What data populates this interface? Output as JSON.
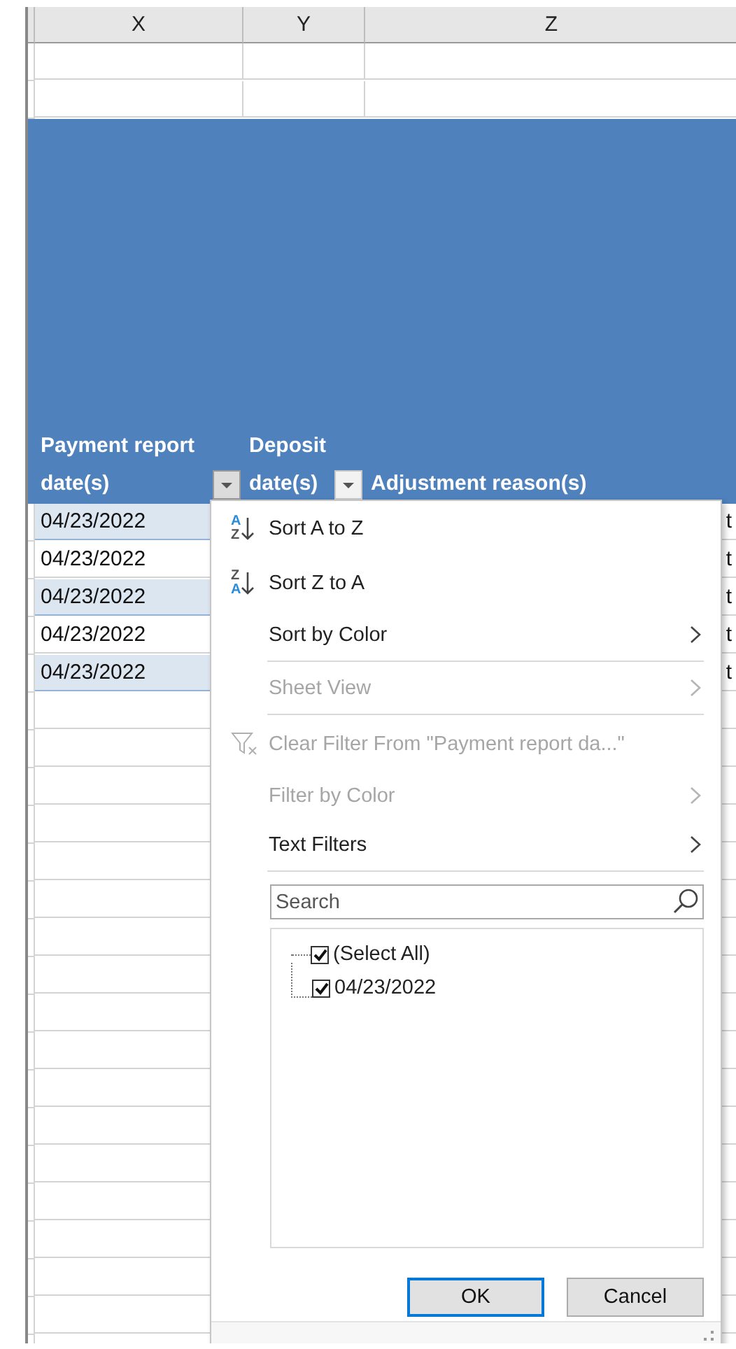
{
  "columns": [
    {
      "label": "X"
    },
    {
      "label": "Y"
    },
    {
      "label": "Z"
    }
  ],
  "header": [
    {
      "lines": [
        "Payment report",
        "date(s)"
      ],
      "filter": {
        "open": true
      }
    },
    {
      "lines": [
        "Deposit",
        "date(s)"
      ],
      "filter": {
        "open": false
      }
    },
    {
      "lines": [
        "Adjustment reason(s)"
      ]
    }
  ],
  "rows": [
    {
      "x": "04/23/2022",
      "z": "t",
      "banded": true
    },
    {
      "x": "04/23/2022",
      "z": "t",
      "banded": false
    },
    {
      "x": "04/23/2022",
      "z": "t",
      "banded": true
    },
    {
      "x": "04/23/2022",
      "z": "t",
      "banded": false
    },
    {
      "x": "04/23/2022",
      "z": "t",
      "banded": true
    }
  ],
  "filter_menu": {
    "groups": [
      [
        {
          "kind": "sort_asc",
          "label": "Sort A to Z",
          "disabled": false,
          "icon": {
            "top": "A",
            "bottom": "Z"
          }
        },
        {
          "kind": "sort_desc",
          "label": "Sort Z to A",
          "disabled": false,
          "icon": {
            "top": "Z",
            "bottom": "A"
          }
        },
        {
          "kind": "submenu",
          "label": "Sort by Color",
          "disabled": false
        }
      ],
      [
        {
          "kind": "submenu",
          "label": "Sheet View",
          "disabled": true
        }
      ],
      [
        {
          "kind": "clear_filter",
          "label": "Clear Filter From \"Payment report da...\"",
          "disabled": true
        },
        {
          "kind": "submenu",
          "label": "Filter by Color",
          "disabled": true
        },
        {
          "kind": "submenu",
          "label": "Text Filters",
          "disabled": false
        }
      ]
    ],
    "search": {
      "placeholder": "Search"
    },
    "values": [
      {
        "label": "(Select All)",
        "checked": true,
        "children": [
          {
            "label": "04/23/2022",
            "checked": true
          }
        ]
      }
    ],
    "buttons": [
      {
        "label": "OK",
        "default": true
      },
      {
        "label": "Cancel",
        "default": false
      }
    ]
  }
}
